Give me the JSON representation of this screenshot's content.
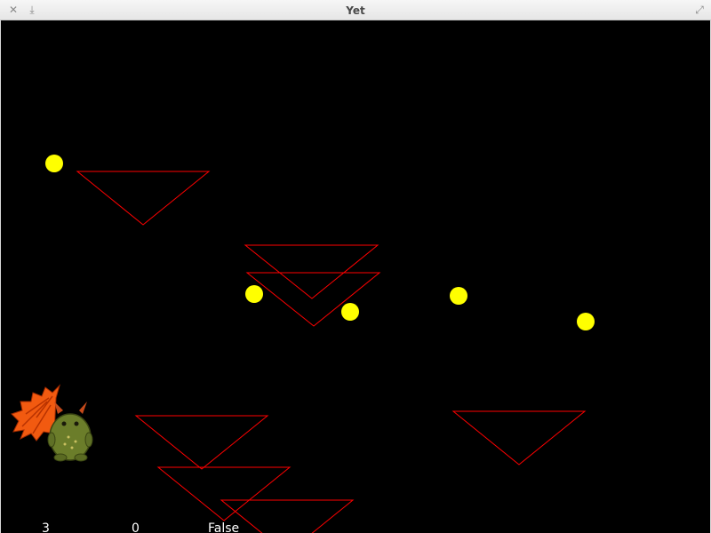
{
  "window": {
    "title": "Yet",
    "close_icon": "close-icon",
    "minimize_icon": "download-icon",
    "maximize_icon": "maximize-icon"
  },
  "game": {
    "background_color": "#000000",
    "platform_color": "#ff0000",
    "coin_color": "#ffff00",
    "hud": {
      "lives": "3",
      "score": "0",
      "state": "False"
    },
    "player": {
      "description": "green horned monster with orange wings",
      "body_color": "#6b7d2a",
      "wing_color": "#f25a10"
    }
  }
}
